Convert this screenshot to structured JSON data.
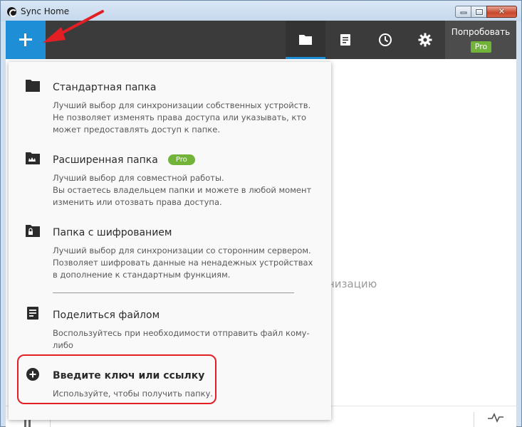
{
  "window": {
    "title": "Sync Home",
    "controls": {
      "minimize": "minimize",
      "maximize": "maximize",
      "close": "close"
    }
  },
  "header": {
    "tabs": [
      {
        "name": "folders",
        "icon": "folder-icon",
        "active": true
      },
      {
        "name": "transfers",
        "icon": "document-icon",
        "active": false
      },
      {
        "name": "history",
        "icon": "clock-icon",
        "active": false
      },
      {
        "name": "settings",
        "icon": "gear-icon",
        "active": false
      }
    ],
    "try_label": "Попробовать",
    "try_badge": "Pro"
  },
  "menu": {
    "items": [
      {
        "icon": "folder-icon",
        "title": "Стандартная папка",
        "desc": [
          "Лучший выбор для синхронизации собственных устройств.",
          "Не позволяет изменять права доступа или указывать, кто",
          "может предоставлять доступ к папке."
        ]
      },
      {
        "icon": "folder-crown-icon",
        "title": "Расширенная папка",
        "badge": "Pro",
        "desc": [
          "Лучший выбор для совместной работы.",
          "Вы остаетесь владельцем папки и можете в любой момент",
          "изменить или отозвать права доступа."
        ]
      },
      {
        "icon": "folder-lock-icon",
        "title": "Папка с шифрованием",
        "desc": [
          "Лучший выбор для синхронизации со сторонним сервером.",
          "Позволяет шифровать данные на ненадежных устройствах",
          "в дополнение к стандартным функциям."
        ]
      },
      {
        "icon": "file-icon",
        "title": "Поделиться файлом",
        "desc": [
          "Воспользуйтесь при необходимости отправить файл кому-",
          "либо"
        ]
      },
      {
        "icon": "plus-circle-icon",
        "title": "Введите ключ или ссылку",
        "desc": [
          "Используйте, чтобы получить папку."
        ]
      }
    ]
  },
  "main": {
    "hint_fragment": "низацию"
  },
  "colors": {
    "accent": "#1e8fd6",
    "header_bg": "#3b3b3b",
    "pro_green": "#72b43a",
    "annotation_red": "#e31f26"
  }
}
